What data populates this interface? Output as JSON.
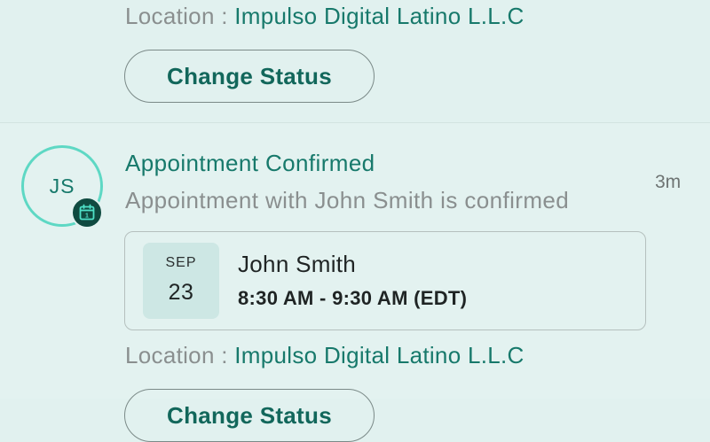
{
  "previous_notification": {
    "location_label": "Location : ",
    "location_value": "Impulso Digital Latino L.L.C",
    "action_label": "Change Status"
  },
  "notification": {
    "avatar_initials": "JS",
    "badge_icon": "calendar-icon",
    "title": "Appointment Confirmed",
    "message": "Appointment with John Smith is confirmed",
    "time_ago": "3m",
    "appointment": {
      "month": "SEP",
      "day": "23",
      "name": "John Smith",
      "time": "8:30 AM - 9:30 AM (EDT)"
    },
    "location_label": "Location : ",
    "location_value": "Impulso Digital Latino L.L.C",
    "action_label": "Change Status"
  },
  "colors": {
    "accent": "#17796b",
    "avatar_ring": "#5ed8c4",
    "badge_bg": "#0f4a40",
    "muted_text": "#8a8f8f",
    "background": "#e1f1ef"
  }
}
